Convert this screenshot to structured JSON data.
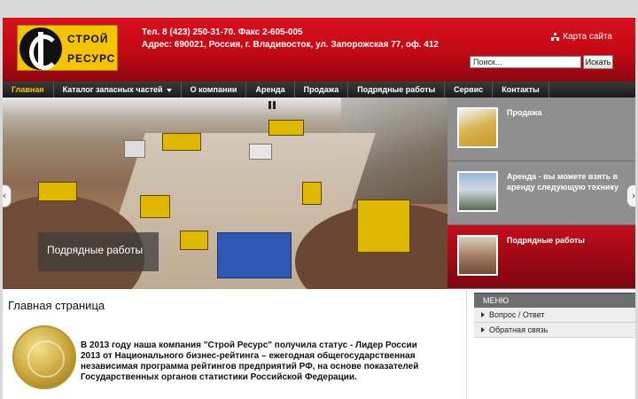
{
  "brand": {
    "line1": "СТРОЙ",
    "line2": "РЕСУРС"
  },
  "header": {
    "phone": "Тел. 8 (423) 250-31-70. Факс 2-605-005",
    "address": "Адрес: 690021, Россия, г. Владивосток, ул. Запорожская 77, оф. 412",
    "sitemap": "Карта сайта",
    "search_value": "Поиск...",
    "search_button": "Искать"
  },
  "nav": {
    "items": [
      "Главная",
      "Каталог запасных частей",
      "О компании",
      "Аренда",
      "Продажа",
      "Подрядные работы",
      "Сервис",
      "Контакты"
    ]
  },
  "slider": {
    "caption": "Подрядные работы",
    "thumbs": [
      "Продажа",
      "Аренда - вы можете взять в аренду следующую технику",
      "Подрядные работы"
    ]
  },
  "content": {
    "title": "Главная страница",
    "text": "В 2013 году наша компания \"Строй Ресурс\" получила статус - Лидер России 2013 от Национального бизнес-рейтинга – ежегодная общегосударственная независимая программа рейтингов предприятий РФ, на основе показателей Государственных органов статистики Российской Федерации."
  },
  "sidebar": {
    "heading": "МЕНЮ",
    "items": [
      "Вопрос / Ответ",
      "Обратная связь"
    ]
  }
}
